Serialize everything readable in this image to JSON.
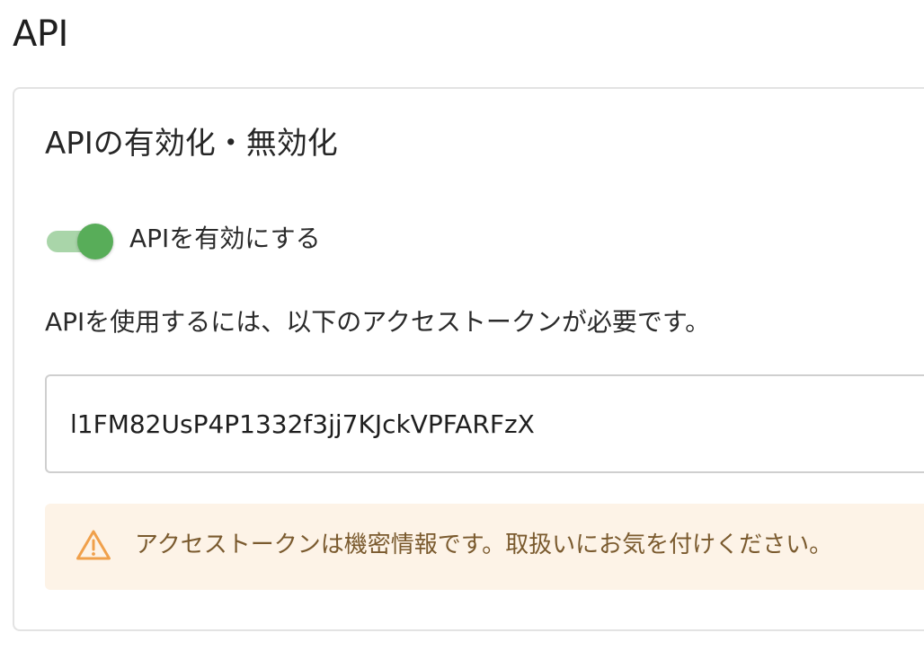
{
  "page": {
    "title": "API"
  },
  "api_card": {
    "title": "APIの有効化・無効化",
    "toggle": {
      "label": "APIを有効にする",
      "enabled": true,
      "color_on": "#58ad59"
    },
    "description": "APIを使用するには、以下のアクセストークンが必要です。",
    "access_token": {
      "value": "l1FM82UsP4P1332f3jj7KJckVPFARFzX"
    },
    "warning": {
      "icon": "warning-triangle-icon",
      "text": "アクセストークンは機密情報です。取扱いにお気を付けください。",
      "icon_color": "#f0a04b",
      "background": "#fdf3e7"
    }
  }
}
